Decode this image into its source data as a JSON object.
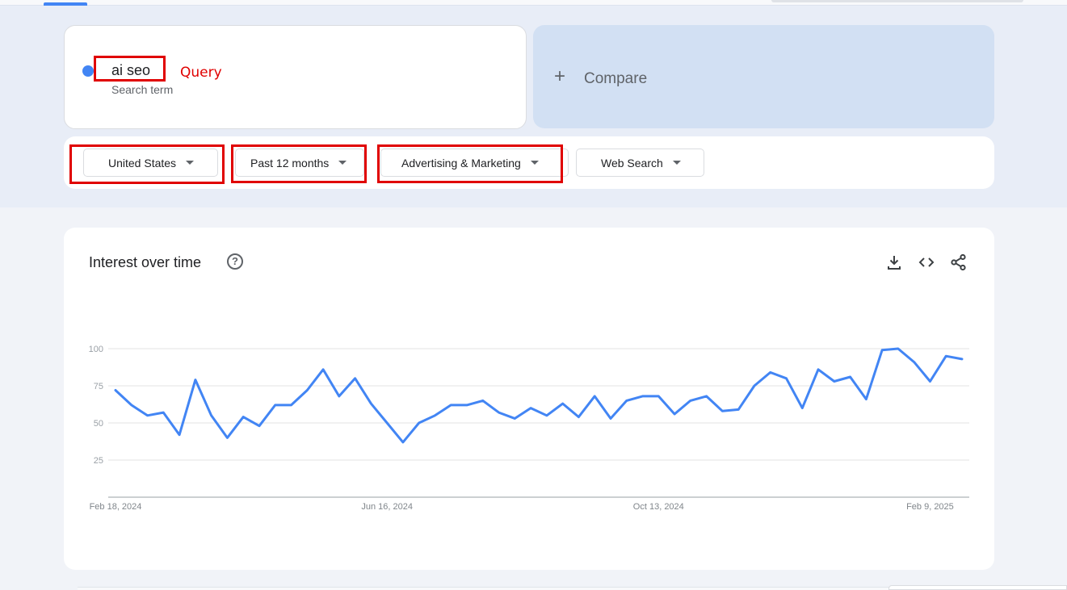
{
  "search_term": {
    "value": "ai seo",
    "subtitle": "Search term",
    "annotation": "Query",
    "series_color": "#4285f4"
  },
  "compare": {
    "label": "Compare",
    "icon": "plus-icon"
  },
  "filters": {
    "region": "United States",
    "time_range": "Past 12 months",
    "category": "Advertising & Marketing",
    "property": "Web Search"
  },
  "annotation_color": "#e00000",
  "interest_panel": {
    "title": "Interest over time",
    "help_icon": "help-icon",
    "actions": [
      "download-icon",
      "embed-code-icon",
      "share-icon"
    ]
  },
  "chart_data": {
    "type": "line",
    "title": "",
    "xlabel": "",
    "ylabel": "",
    "ylim": [
      0,
      100
    ],
    "y_ticks": [
      "100",
      "75",
      "50",
      "25"
    ],
    "x_tick_labels": [
      "Feb 18, 2024",
      "Jun 16, 2024",
      "Oct 13, 2024",
      "Feb 9, 2025"
    ],
    "x_tick_indices": [
      0,
      17,
      34,
      51
    ],
    "grid": true,
    "series": [
      {
        "color": "#4285f4",
        "values": [
          72,
          62,
          55,
          57,
          42,
          79,
          55,
          40,
          54,
          48,
          62,
          62,
          72,
          86,
          68,
          80,
          63,
          50,
          37,
          50,
          55,
          62,
          62,
          65,
          57,
          53,
          60,
          55,
          63,
          54,
          68,
          53,
          65,
          68,
          68,
          56,
          65,
          68,
          58,
          59,
          75,
          84,
          80,
          60,
          86,
          78,
          81,
          66,
          99,
          100,
          91,
          78,
          95,
          93
        ]
      }
    ]
  }
}
